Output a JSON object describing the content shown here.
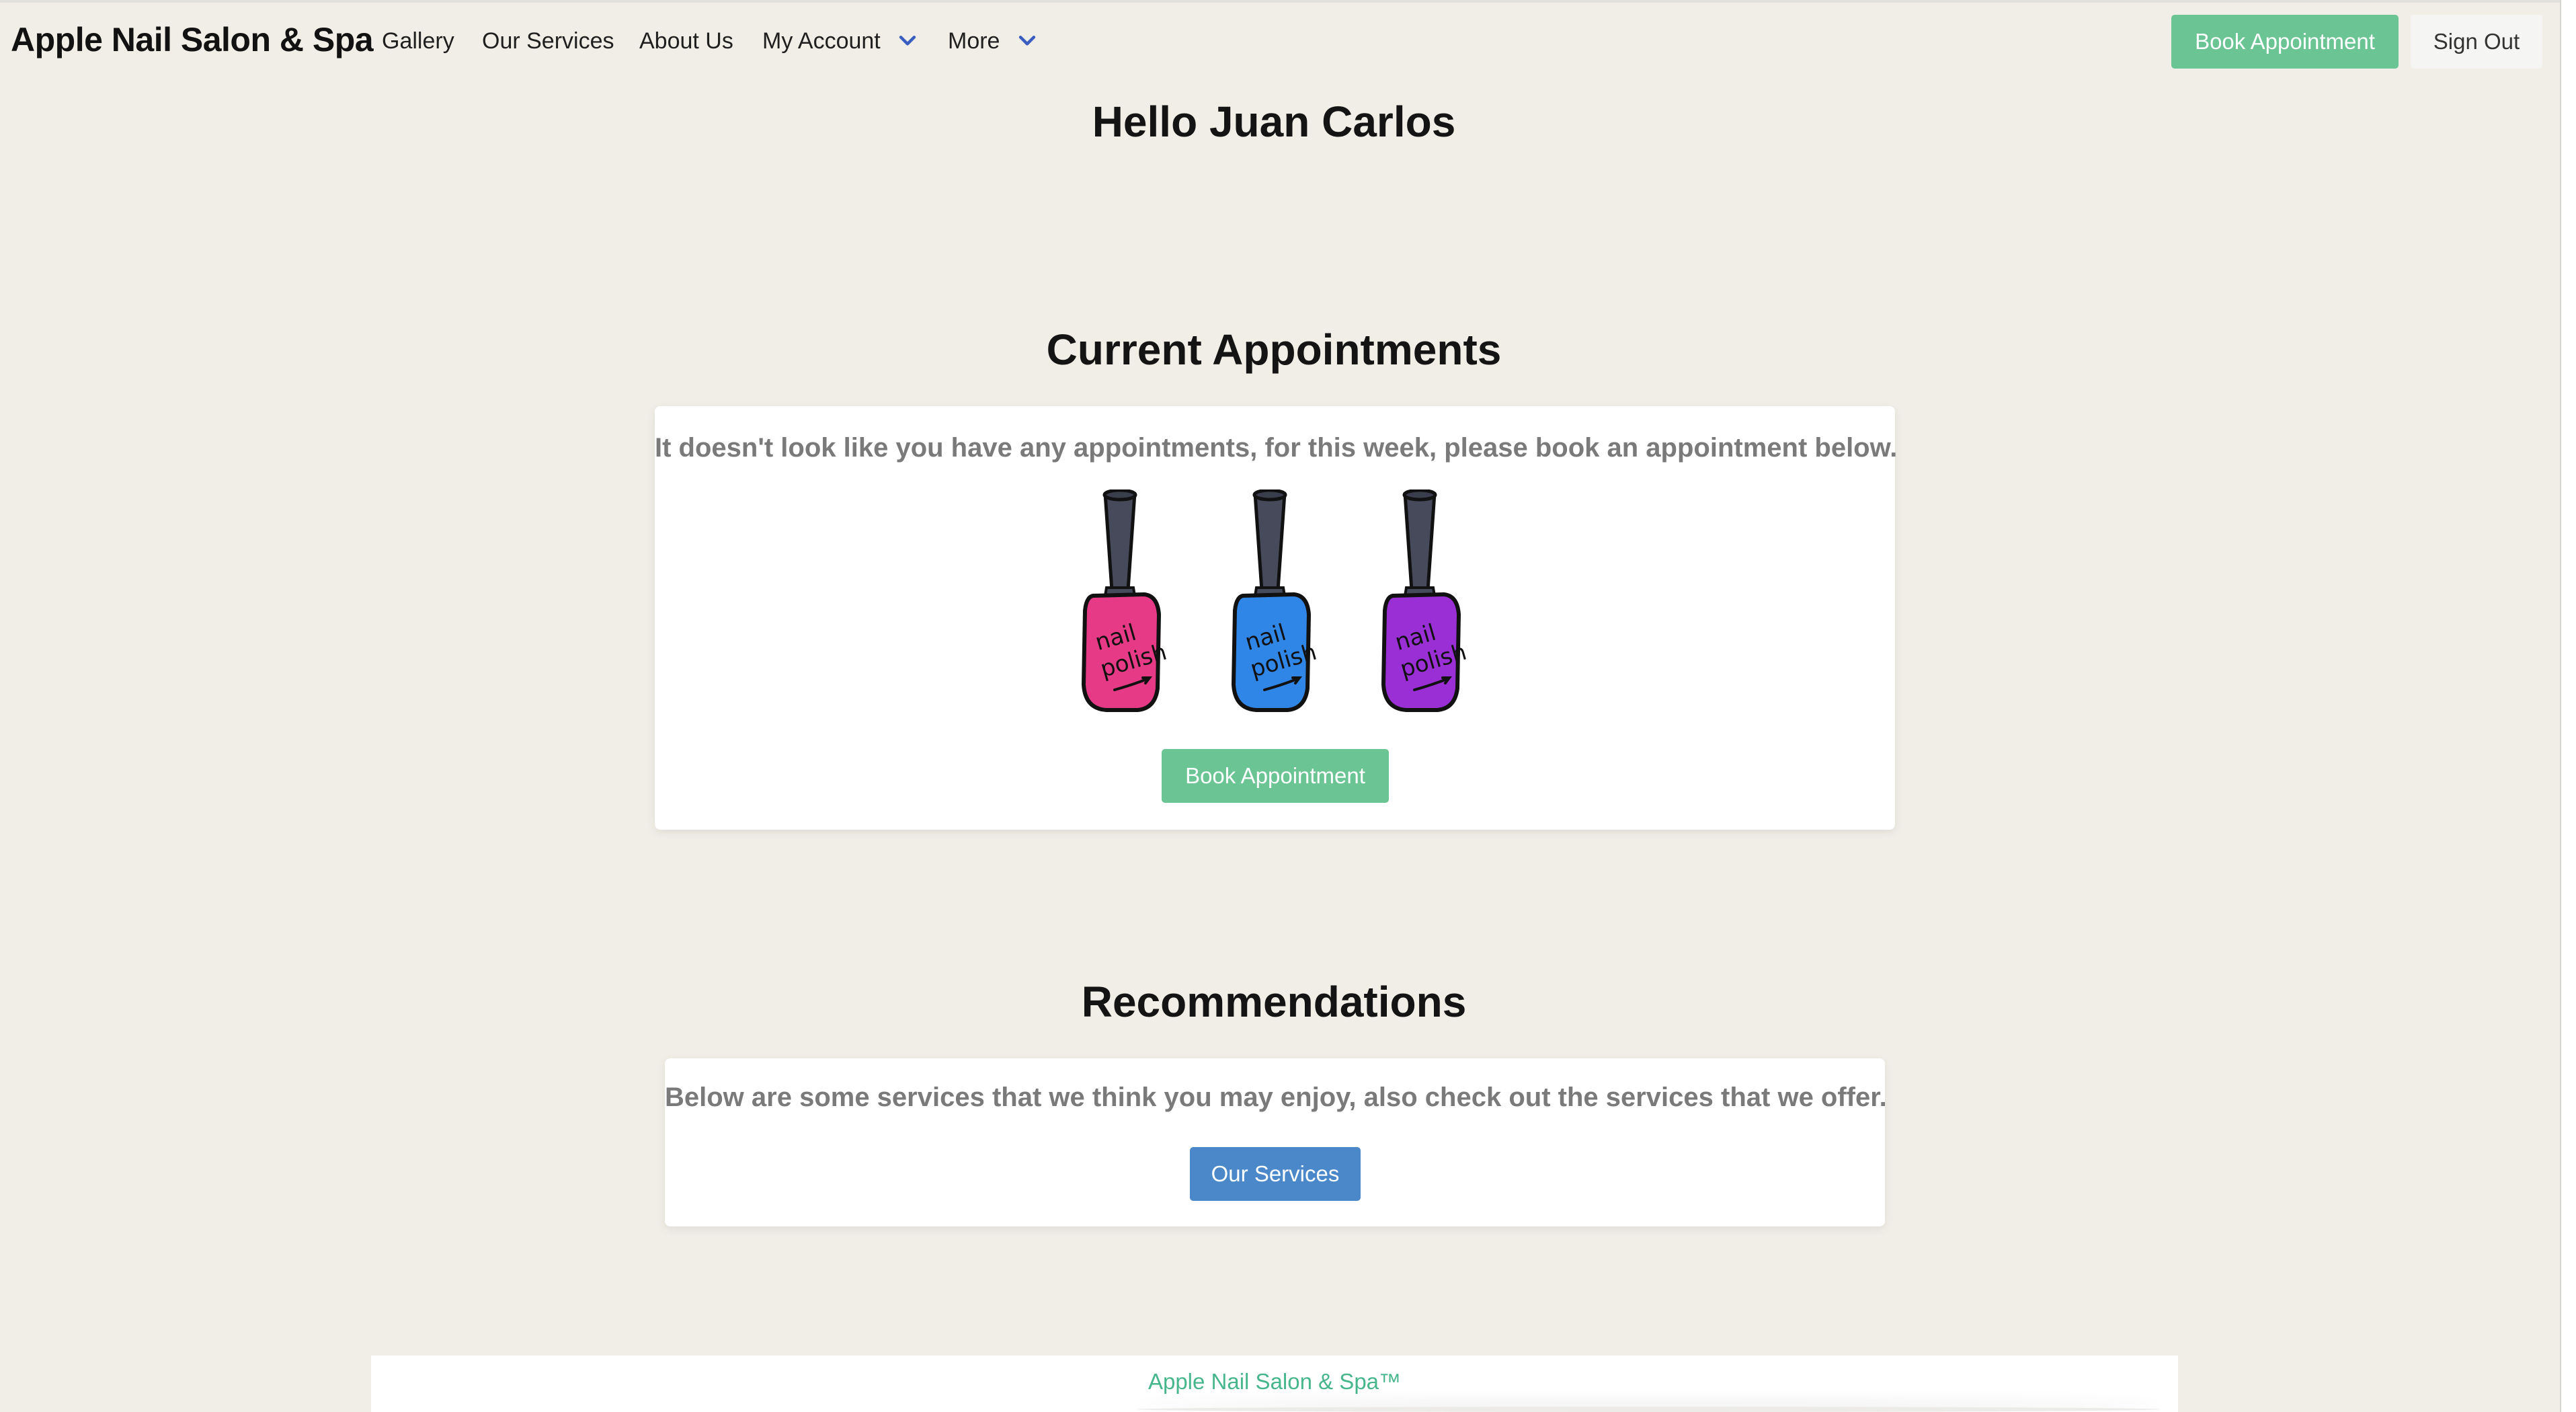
{
  "navbar": {
    "brand": "Apple Nail Salon & Spa",
    "items": [
      {
        "label": "Gallery"
      },
      {
        "label": "Our Services"
      },
      {
        "label": "About Us"
      },
      {
        "label": "My Account",
        "dropdown": true
      },
      {
        "label": "More",
        "dropdown": true
      }
    ],
    "book_label": "Book Appointment",
    "signout_label": "Sign Out"
  },
  "greeting": "Hello Juan Carlos",
  "current_appointments": {
    "title": "Current Appointments",
    "message": "It doesn't look like you have any appointments, for this week, please book an appointment below.",
    "image_text": [
      "nail",
      "polish"
    ],
    "book_label": "Book Appointment"
  },
  "recommendations": {
    "title": "Recommendations",
    "message": "Below are some services that we think you may enjoy, also check out the services that we offer.",
    "services_label": "Our Services"
  },
  "footer": {
    "text": "Apple Nail Salon & Spa™"
  },
  "colors": {
    "background": "#f1eee8",
    "primary_green": "#6ac493",
    "primary_blue": "#4a88c9",
    "footer_text": "#46b68c",
    "polish_pink": "#e63a86",
    "polish_blue": "#2f86e6",
    "polish_purple": "#9a2fd6",
    "polish_cap": "#464a5a"
  },
  "icons": [
    "chevron-down-icon",
    "nail-polish-illustration"
  ]
}
